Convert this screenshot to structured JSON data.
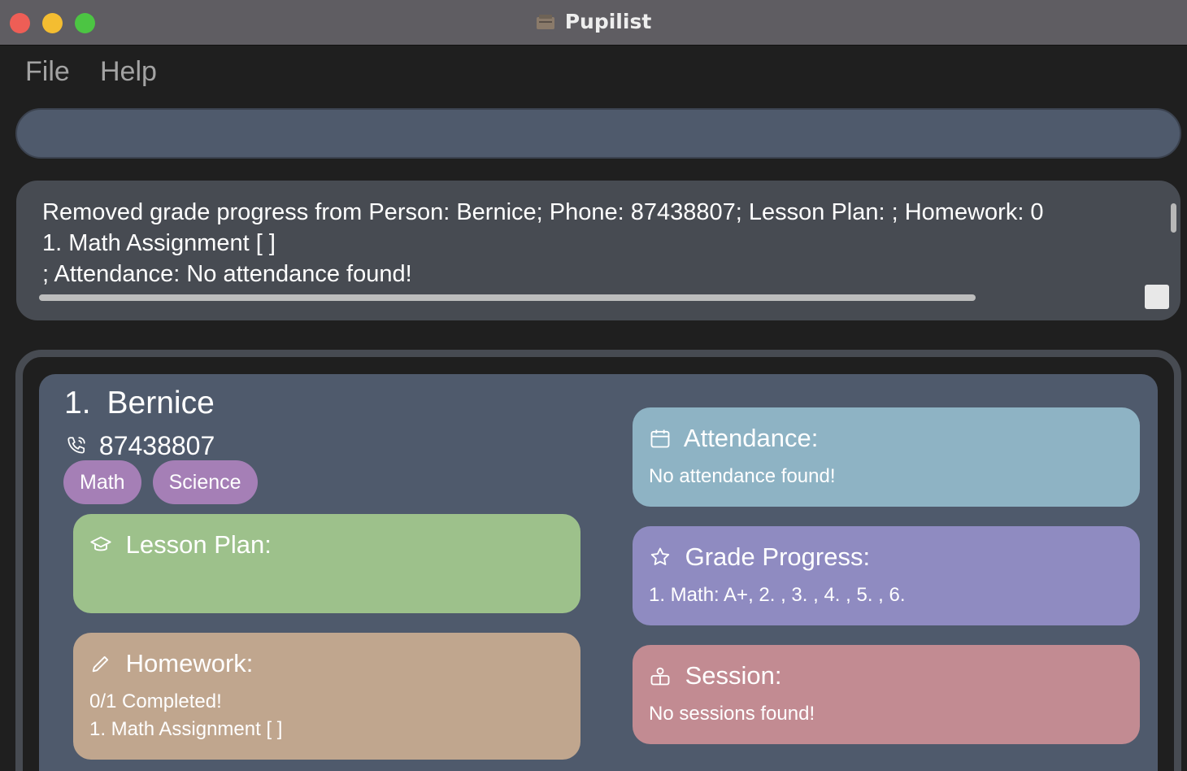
{
  "window": {
    "title": "Pupilist"
  },
  "menu": {
    "file": "File",
    "help": "Help"
  },
  "command_box": {
    "value": ""
  },
  "result_display": {
    "text": "Removed grade progress from Person: Bernice; Phone: 87438807; Lesson Plan: ; Homework: 0\n1. Math Assignment [ ]\n; Attendance: No attendance found!"
  },
  "person": {
    "index": "1.",
    "name": "Bernice",
    "phone": "87438807",
    "tags": [
      "Math",
      "Science"
    ],
    "lesson_plan": {
      "title": "Lesson Plan:",
      "body": ""
    },
    "homework": {
      "title": "Homework:",
      "body": "0/1 Completed!\n1. Math Assignment [ ]"
    },
    "attendance": {
      "title": "Attendance:",
      "body": "No attendance found!"
    },
    "grade_progress": {
      "title": "Grade Progress:",
      "body": "1. Math: A+, 2. , 3. , 4. , 5. , 6."
    },
    "session": {
      "title": "Session:",
      "body": "No sessions found!"
    }
  },
  "colors": {
    "lesson_plan": "#9dc18b",
    "homework": "#c0a68e",
    "attendance": "#8eb3c4",
    "grade_progress": "#8f8bc1",
    "session": "#c28b92",
    "tag": "#a57fb6"
  }
}
